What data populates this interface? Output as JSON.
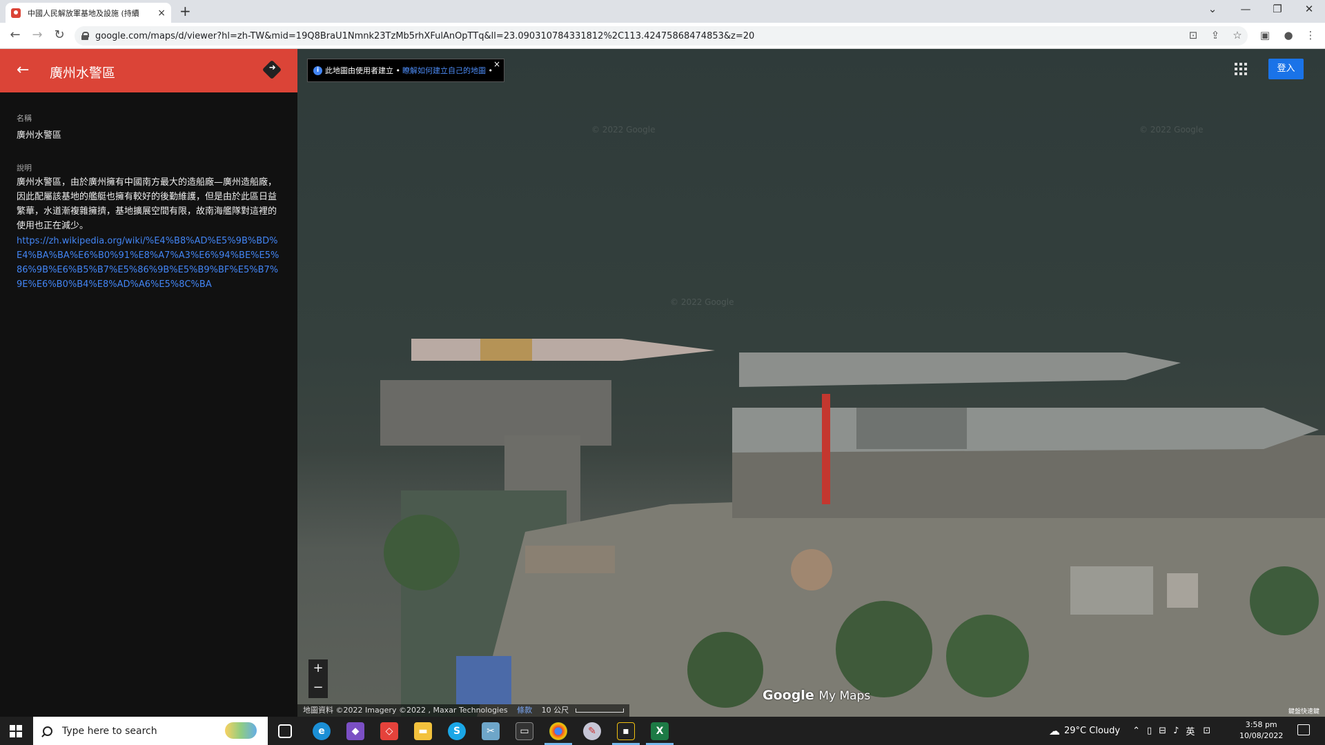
{
  "browser": {
    "tab_title": "中國人民解放軍基地及設施 (持續",
    "tab_close": "×",
    "new_tab": "+",
    "url": "google.com/maps/d/viewer?hl=zh-TW&mid=19Q8BraU1Nmnk23TzMb5rhXFulAnOpTTq&ll=23.090310784331812%2C113.42475868474853&z=20"
  },
  "panel": {
    "title": "廣州水警區",
    "name_label": "名稱",
    "name_value": "廣州水警區",
    "desc_label": "說明",
    "description": "廣州水警區，由於廣州擁有中國南方最大的造船廠—廣州造船廠，因此配屬該基地的艦艇也擁有較好的後勤維護，但是由於此區日益繁華，水道漸複雜擁擠，基地擴展空間有限，故南海艦隊對這裡的使用也正在減少。",
    "wiki_link": "https://zh.wikipedia.org/wiki/%E4%B8%AD%E5%9B%BD%E4%BA%BA%E6%B0%91%E8%A7%A3%E6%94%BE%E5%86%9B%E6%B5%B7%E5%86%9B%E5%B9%BF%E5%B7%9E%E6%B0%B4%E8%AD%A6%E5%8C%BA"
  },
  "map": {
    "info_text": "此地圖由使用者建立",
    "info_link": "瞭解如何建立自己的地圖",
    "info_close": "×",
    "signin": "登入",
    "zoom_in": "+",
    "zoom_out": "−",
    "logo_google": "Google",
    "logo_mymaps": "My Maps",
    "attribution": "地圖資料 ©2022 Imagery ©2022 , Maxar Technologies",
    "terms": "條款",
    "scale": "10 公尺",
    "shortcuts": "鍵盤快速鍵",
    "watermark": "© 2022 Google"
  },
  "taskbar": {
    "search_placeholder": "Type here to search",
    "weather": "29°C  Cloudy",
    "ime": "英",
    "time": "3:58 pm",
    "date": "10/08/2022"
  }
}
